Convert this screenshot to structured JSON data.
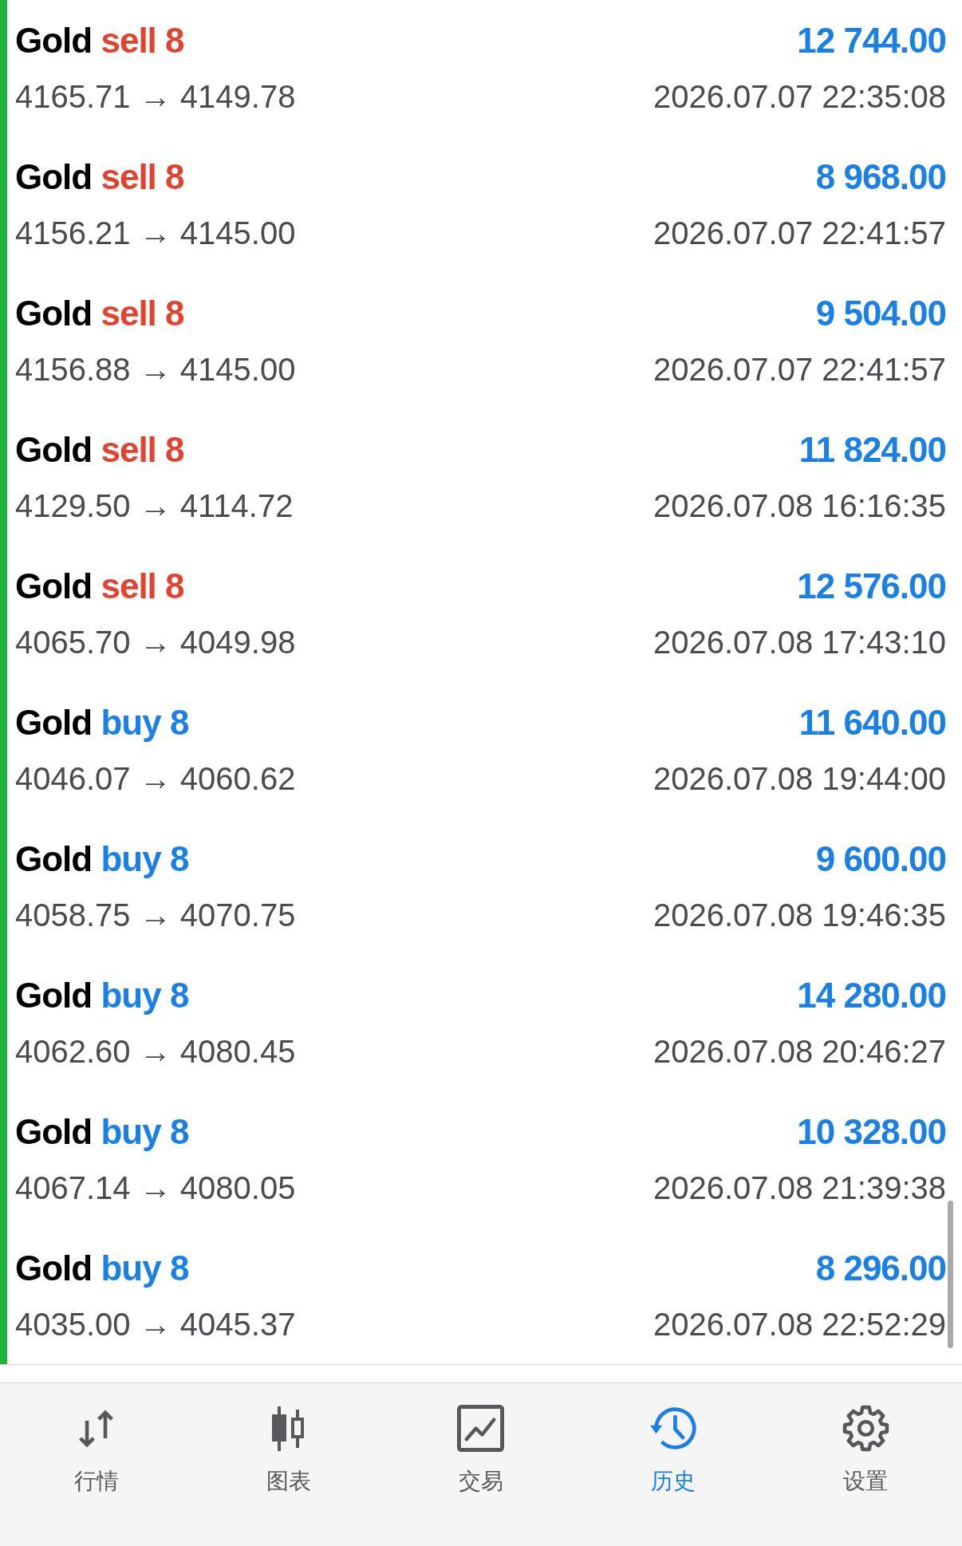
{
  "trades": [
    {
      "symbol": "Gold",
      "side": "sell",
      "kind": "sell",
      "volume": "8",
      "prices": "4165.71 → 4149.78",
      "profit": "12 744.00",
      "time": "2026.07.07 22:35:08"
    },
    {
      "symbol": "Gold",
      "side": "sell",
      "kind": "sell",
      "volume": "8",
      "prices": "4156.21 → 4145.00",
      "profit": "8 968.00",
      "time": "2026.07.07 22:41:57"
    },
    {
      "symbol": "Gold",
      "side": "sell",
      "kind": "sell",
      "volume": "8",
      "prices": "4156.88 → 4145.00",
      "profit": "9 504.00",
      "time": "2026.07.07 22:41:57"
    },
    {
      "symbol": "Gold",
      "side": "sell",
      "kind": "sell",
      "volume": "8",
      "prices": "4129.50 → 4114.72",
      "profit": "11 824.00",
      "time": "2026.07.08 16:16:35"
    },
    {
      "symbol": "Gold",
      "side": "sell",
      "kind": "sell",
      "volume": "8",
      "prices": "4065.70 → 4049.98",
      "profit": "12 576.00",
      "time": "2026.07.08 17:43:10"
    },
    {
      "symbol": "Gold",
      "side": "buy",
      "kind": "buy",
      "volume": "8",
      "prices": "4046.07 → 4060.62",
      "profit": "11 640.00",
      "time": "2026.07.08 19:44:00"
    },
    {
      "symbol": "Gold",
      "side": "buy",
      "kind": "buy",
      "volume": "8",
      "prices": "4058.75 → 4070.75",
      "profit": "9 600.00",
      "time": "2026.07.08 19:46:35"
    },
    {
      "symbol": "Gold",
      "side": "buy",
      "kind": "buy",
      "volume": "8",
      "prices": "4062.60 → 4080.45",
      "profit": "14 280.00",
      "time": "2026.07.08 20:46:27"
    },
    {
      "symbol": "Gold",
      "side": "buy",
      "kind": "buy",
      "volume": "8",
      "prices": "4067.14 → 4080.05",
      "profit": "10 328.00",
      "time": "2026.07.08 21:39:38"
    },
    {
      "symbol": "Gold",
      "side": "buy",
      "kind": "buy",
      "volume": "8",
      "prices": "4035.00 → 4045.37",
      "profit": "8 296.00",
      "time": "2026.07.08 22:52:29"
    }
  ],
  "tab_bar": {
    "tabs": [
      {
        "label": "行情",
        "kind": "quotes",
        "selected": false
      },
      {
        "label": "图表",
        "kind": "chart",
        "selected": false
      },
      {
        "label": "交易",
        "kind": "trade",
        "selected": false
      },
      {
        "label": "历史",
        "kind": "history",
        "selected": true
      },
      {
        "label": "设置",
        "kind": "settings",
        "selected": false
      }
    ]
  }
}
